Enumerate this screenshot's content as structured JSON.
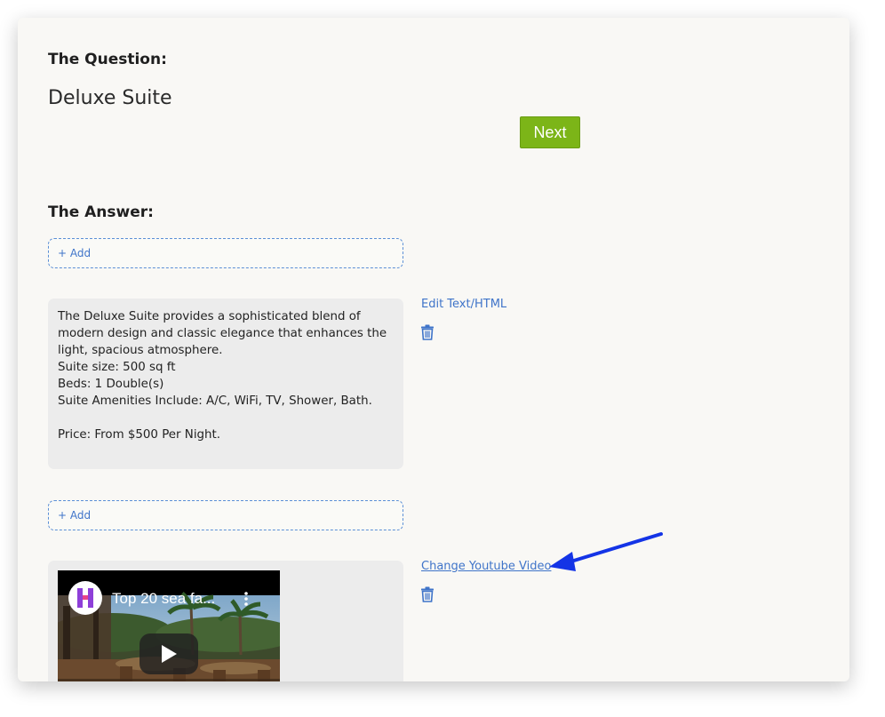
{
  "question": {
    "heading": "The Question:",
    "title": "Deluxe Suite",
    "next_label": "Next"
  },
  "answer": {
    "heading": "The Answer:",
    "add_label": "+ Add",
    "text_block": {
      "lines": [
        "The Deluxe Suite provides a sophisticated blend of",
        "modern design and classic elegance that enhances the",
        "light, spacious atmosphere.",
        "Suite size: 500 sq ft",
        "Beds: 1 Double(s)",
        "Suite Amenities Include: A/C, WiFi, TV, Shower, Bath.",
        "",
        "Price: From $500 Per Night."
      ],
      "edit_label": "Edit Text/HTML"
    },
    "video_block": {
      "change_label": "Change Youtube Video",
      "video_title": "Top 20 sea fa...",
      "channel_letter": "H"
    }
  },
  "colors": {
    "next_button": "#7cb518",
    "link": "#3f74c9",
    "annotation_arrow": "#1434e6"
  },
  "icons": {
    "delete": "trash-icon",
    "play": "play-icon",
    "more": "kebab-menu-icon"
  }
}
